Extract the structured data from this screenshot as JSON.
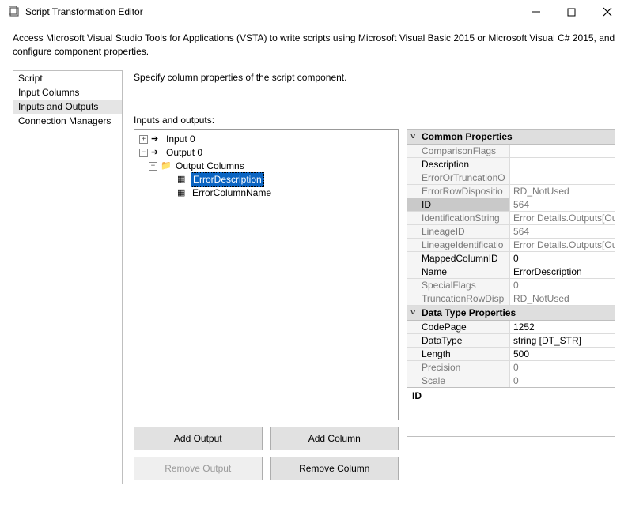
{
  "window": {
    "title": "Script Transformation Editor"
  },
  "description": "Access Microsoft Visual Studio Tools for Applications (VSTA) to write scripts using Microsoft Visual Basic 2015 or Microsoft Visual C# 2015, and configure component properties.",
  "nav": {
    "items": [
      "Script",
      "Input Columns",
      "Inputs and Outputs",
      "Connection Managers"
    ],
    "selected_index": 2
  },
  "content": {
    "header": "Specify column properties of the script component.",
    "io_label": "Inputs and outputs:",
    "tree": {
      "input0": "Input 0",
      "output0": "Output 0",
      "output_columns": "Output Columns",
      "error_description": "ErrorDescription",
      "error_column_name": "ErrorColumnName"
    },
    "buttons": {
      "add_output": "Add Output",
      "add_column": "Add Column",
      "remove_output": "Remove Output",
      "remove_column": "Remove Column"
    }
  },
  "props": {
    "cat_common": "Common Properties",
    "cat_datatype": "Data Type Properties",
    "common": {
      "ComparisonFlags": "",
      "Description": "",
      "ErrorOrTruncationO": "",
      "ErrorRowDispositio": "RD_NotUsed",
      "ID": "564",
      "IdentificationString": "Error Details.Outputs[Outp",
      "LineageID": "564",
      "LineageIdentificatio": "Error Details.Outputs[Outp",
      "MappedColumnID": "0",
      "Name": "ErrorDescription",
      "SpecialFlags": "0",
      "TruncationRowDisp": "RD_NotUsed"
    },
    "datatype": {
      "CodePage": "1252",
      "DataType": "string [DT_STR]",
      "Length": "500",
      "Precision": "0",
      "Scale": "0"
    },
    "desc_label": "ID"
  }
}
